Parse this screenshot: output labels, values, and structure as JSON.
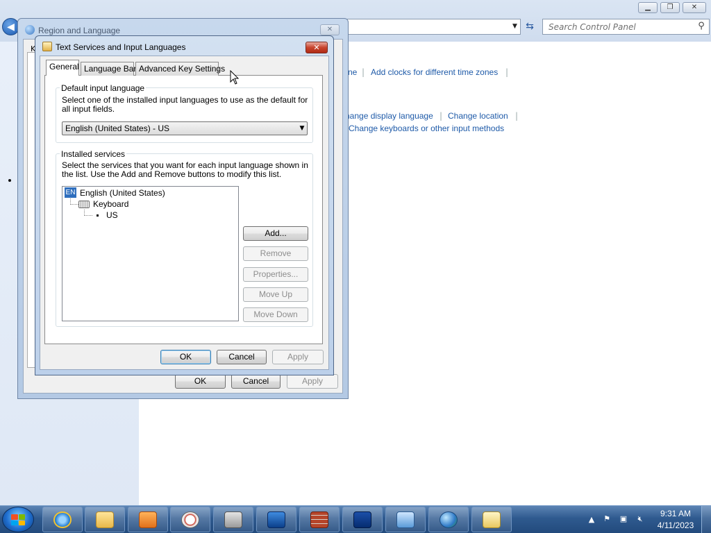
{
  "control_panel": {
    "search_placeholder": "Search Control Panel",
    "links_row1": [
      "ne",
      "Add clocks for different time zones"
    ],
    "links_row2": [
      "hange display language",
      "Change location"
    ],
    "links_row3": "Change keyboards or other input methods",
    "window_buttons": [
      "minimize",
      "maximize",
      "close"
    ]
  },
  "region_window": {
    "title": "Region and Language",
    "partial_tab": "K",
    "ok": "OK",
    "cancel": "Cancel",
    "apply": "Apply"
  },
  "dialog": {
    "title": "Text Services and Input Languages",
    "tabs": [
      "General",
      "Language Bar",
      "Advanced Key Settings"
    ],
    "active_tab": "General",
    "default_group": {
      "label": "Default input language",
      "description": "Select one of the installed input languages to use as the default for all input fields.",
      "selected": "English (United States) - US"
    },
    "services_group": {
      "label": "Installed services",
      "description": "Select the services that you want for each input language shown in the list. Use the Add and Remove buttons to modify this list.",
      "tree": {
        "language_badge": "EN",
        "language": "English (United States)",
        "category": "Keyboard",
        "layout": "US"
      },
      "buttons": {
        "add": "Add...",
        "remove": "Remove",
        "properties": "Properties...",
        "move_up": "Move Up",
        "move_down": "Move Down"
      }
    },
    "footer": {
      "ok": "OK",
      "cancel": "Cancel",
      "apply": "Apply"
    }
  },
  "taskbar": {
    "apps": [
      "internet-explorer",
      "windows-explorer",
      "media-player",
      "compass-app",
      "admin-tools",
      "powershell",
      "firewall",
      "remote-desktop",
      "control-panel",
      "region-globe",
      "keyboard-input"
    ],
    "clock_time": "9:31 AM",
    "clock_date": "4/11/2023"
  }
}
